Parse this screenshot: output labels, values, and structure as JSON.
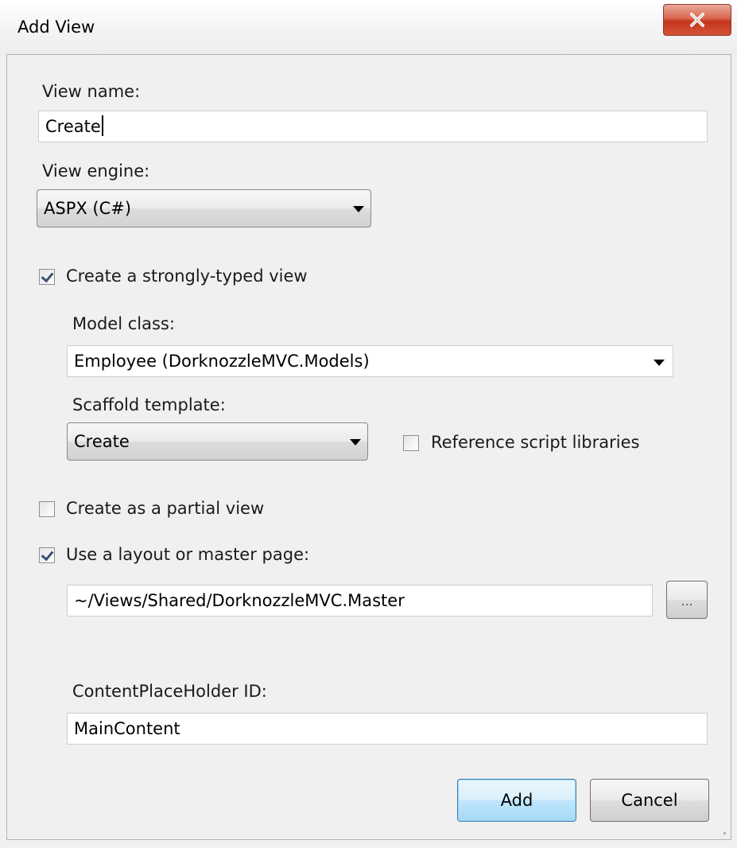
{
  "window": {
    "title": "Add View",
    "close_icon": "X"
  },
  "view_name": {
    "label": "View name:",
    "value": "Create"
  },
  "view_engine": {
    "label": "View engine:",
    "selected": "ASPX (C#)"
  },
  "strongly_typed": {
    "label": "Create a strongly-typed view",
    "checked": true
  },
  "model_class": {
    "label": "Model class:",
    "selected": "Employee (DorknozzleMVC.Models)"
  },
  "scaffold": {
    "label": "Scaffold template:",
    "selected": "Create"
  },
  "reference_scripts": {
    "label": "Reference script libraries",
    "checked": false
  },
  "partial_view": {
    "label": "Create as a partial view",
    "checked": false
  },
  "master_page": {
    "label": "Use a layout or master page:",
    "checked": true,
    "path": "~/Views/Shared/DorknozzleMVC.Master",
    "browse_label": "..."
  },
  "content_placeholder": {
    "label": "ContentPlaceHolder ID:",
    "value": "MainContent"
  },
  "buttons": {
    "add": "Add",
    "cancel": "Cancel"
  }
}
